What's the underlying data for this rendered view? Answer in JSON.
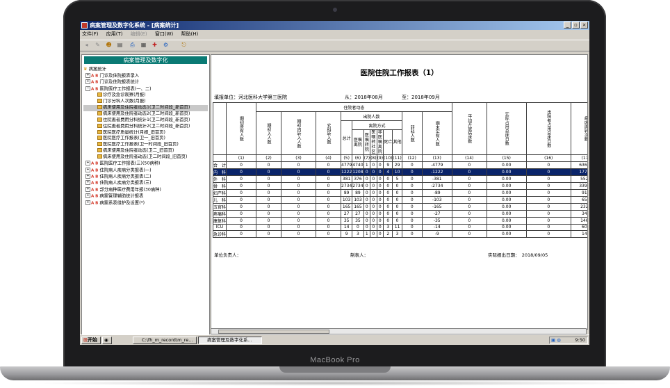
{
  "device": {
    "label": "MacBook Pro"
  },
  "window": {
    "title": "病案管理及数字化系统 - [病案统计]",
    "menu": [
      "文件(F)",
      "应用(T)",
      "编辑(E)",
      "窗口(W)",
      "帮助(H)"
    ]
  },
  "sidebar": {
    "header": "病案管理及数字化",
    "root": "病案统计",
    "items": [
      {
        "label": "门诊及住院报表录入",
        "type": "group"
      },
      {
        "label": "门诊及住院报表统计",
        "type": "group"
      },
      {
        "label": "医院医疗工作报表(一、二)",
        "type": "group-open"
      },
      {
        "label": "诊疗及急诊观察(月报)",
        "type": "report"
      },
      {
        "label": "门诊分科人次数(月报)",
        "type": "report"
      },
      {
        "label": "病床使用及住院者动态1(卫二时间段_新首页)",
        "type": "report",
        "selected": true
      },
      {
        "label": "病床使用及住院者动态2(卫二时间段_新首页)",
        "type": "report"
      },
      {
        "label": "住院患者费用分科统计1(卫二时间段_新首页)",
        "type": "report"
      },
      {
        "label": "住院患者费用分科统计2(卫二时间段_新首页)",
        "type": "report"
      },
      {
        "label": "医院医疗质量统计(月报_旧首页)",
        "type": "report"
      },
      {
        "label": "医院医疗工作报表(卫一_旧首页)",
        "type": "report"
      },
      {
        "label": "医院医疗工作报表(卫一时间段_旧首页)",
        "type": "report"
      },
      {
        "label": "病床使用及住院者动态(卫二_旧首页)",
        "type": "report"
      },
      {
        "label": "病床使用及住院者动态(卫二时间段_旧首页)",
        "type": "report"
      },
      {
        "label": "医院医疗工作报表(三)(50病种)",
        "type": "group"
      },
      {
        "label": "住院病人疾病分类报表(一)",
        "type": "group"
      },
      {
        "label": "住院病人疾病分类报表(二)",
        "type": "group"
      },
      {
        "label": "住院病人疾病分类报表(三)",
        "type": "group"
      },
      {
        "label": "部分病种医疗费用年报(30病种)",
        "type": "group"
      },
      {
        "label": "病案管理辅助统计报表",
        "type": "group"
      },
      {
        "label": "病案系表维护及设置(*)",
        "type": "group"
      }
    ]
  },
  "report": {
    "title": "医院住院工作报表（1）",
    "unit_label": "填报单位：河北医科大学第三医院",
    "from_label": "从：2018年08月",
    "to_label": "至：2018年09月",
    "h_dept": "科室",
    "h_begin": "期初原有人数",
    "h_dynamics": "住院者动态",
    "h_admit": "入院人数",
    "h_discharge": "出院人数",
    "h_leave_method": "离院方式",
    "h_cols": [
      "期初入人数",
      "期初内转入人数",
      "它科转入数",
      "总计",
      "医嘱离院",
      "医嘱转院",
      "医嘱转社区",
      "非医嘱离院",
      "死亡",
      "其他",
      "转科人数",
      "期末实有人数",
      "实际开放总床日数",
      "平均开放病床数",
      "实际占用总床日数",
      "出院者占用总床日数",
      "病床周转次数",
      "病床使用率%",
      "平均病床工作日",
      "每日平均住院人数"
    ],
    "col_numbers": [
      "(1)",
      "(2)",
      "(3)",
      "(4)",
      "(5)",
      "(6)",
      "(7)",
      "(8)",
      "(9)",
      "(10)",
      "(11)",
      "(12)",
      "(13)",
      "(14)",
      "(15)",
      "(16)",
      "(17)",
      "(18)",
      "(19)",
      "(20)",
      "(21)"
    ],
    "rows": [
      {
        "dept": "合　计",
        "vals": [
          "0",
          "0",
          "0",
          "0",
          "4779",
          "4740",
          "1",
          "0",
          "0",
          "9",
          "29",
          "0",
          "-4779",
          "0",
          "0.00",
          "0",
          "63669",
          "",
          "",
          "",
          "0.0"
        ]
      },
      {
        "dept": "内　科",
        "hl": true,
        "vals": [
          "0",
          "0",
          "0",
          "0",
          "1222",
          "1208",
          "0",
          "0",
          "0",
          "4",
          "10",
          "0",
          "-1222",
          "0",
          "0.00",
          "0",
          "17745",
          "",
          "",
          "",
          "0.0"
        ]
      },
      {
        "dept": "外　科",
        "vals": [
          "0",
          "0",
          "0",
          "0",
          "381",
          "376",
          "0",
          "0",
          "0",
          "0",
          "5",
          "0",
          "-381",
          "0",
          "0.00",
          "0",
          "5521",
          "",
          "",
          "",
          "0.0"
        ]
      },
      {
        "dept": "骨　科",
        "vals": [
          "0",
          "0",
          "0",
          "0",
          "2734",
          "2734",
          "0",
          "0",
          "0",
          "0",
          "0",
          "0",
          "-2734",
          "0",
          "0.00",
          "0",
          "33965",
          "",
          "",
          "",
          "0.0"
        ]
      },
      {
        "dept": "妇产科",
        "vals": [
          "0",
          "0",
          "0",
          "0",
          "89",
          "89",
          "0",
          "0",
          "0",
          "0",
          "0",
          "0",
          "-89",
          "0",
          "0.00",
          "0",
          "913",
          "",
          "",
          "",
          "0.0"
        ]
      },
      {
        "dept": "儿　科",
        "vals": [
          "0",
          "0",
          "0",
          "0",
          "103",
          "103",
          "0",
          "0",
          "0",
          "0",
          "0",
          "0",
          "-103",
          "0",
          "0.00",
          "0",
          "654",
          "",
          "",
          "",
          "0.0"
        ]
      },
      {
        "dept": "五官科",
        "vals": [
          "0",
          "0",
          "0",
          "0",
          "165",
          "165",
          "0",
          "0",
          "0",
          "0",
          "0",
          "0",
          "-165",
          "0",
          "0.00",
          "0",
          "2327",
          "",
          "",
          "",
          "0.0"
        ]
      },
      {
        "dept": "疼痛科",
        "vals": [
          "0",
          "0",
          "0",
          "0",
          "27",
          "27",
          "0",
          "0",
          "0",
          "0",
          "0",
          "0",
          "-27",
          "0",
          "0.00",
          "0",
          "345",
          "",
          "",
          "",
          "0.0"
        ]
      },
      {
        "dept": "康复科",
        "vals": [
          "0",
          "0",
          "0",
          "0",
          "35",
          "35",
          "0",
          "0",
          "0",
          "0",
          "0",
          "0",
          "-35",
          "0",
          "0.00",
          "0",
          "1466",
          "",
          "",
          "",
          "0.0"
        ]
      },
      {
        "dept": "ICU",
        "vals": [
          "0",
          "0",
          "0",
          "0",
          "14",
          "0",
          "0",
          "0",
          "0",
          "3",
          "11",
          "0",
          "-14",
          "0",
          "0.00",
          "0",
          "605",
          "",
          "",
          "",
          "0.0"
        ]
      },
      {
        "dept": "急诊科",
        "vals": [
          "0",
          "0",
          "0",
          "0",
          "9",
          "3",
          "1",
          "0",
          "0",
          "2",
          "3",
          "0",
          "-9",
          "0",
          "0.00",
          "0",
          "148",
          "",
          "",
          "",
          "0.0"
        ]
      }
    ],
    "footer_head": "单位负责人：",
    "footer_maker": "制表人：",
    "footer_date": "实际报出日期：　2018/09/05"
  },
  "taskbar": {
    "start": "开始",
    "tasks": [
      "C:\\fh_m_record\\m_re...",
      "病案管理及数字化系..."
    ],
    "time": "9:50"
  }
}
